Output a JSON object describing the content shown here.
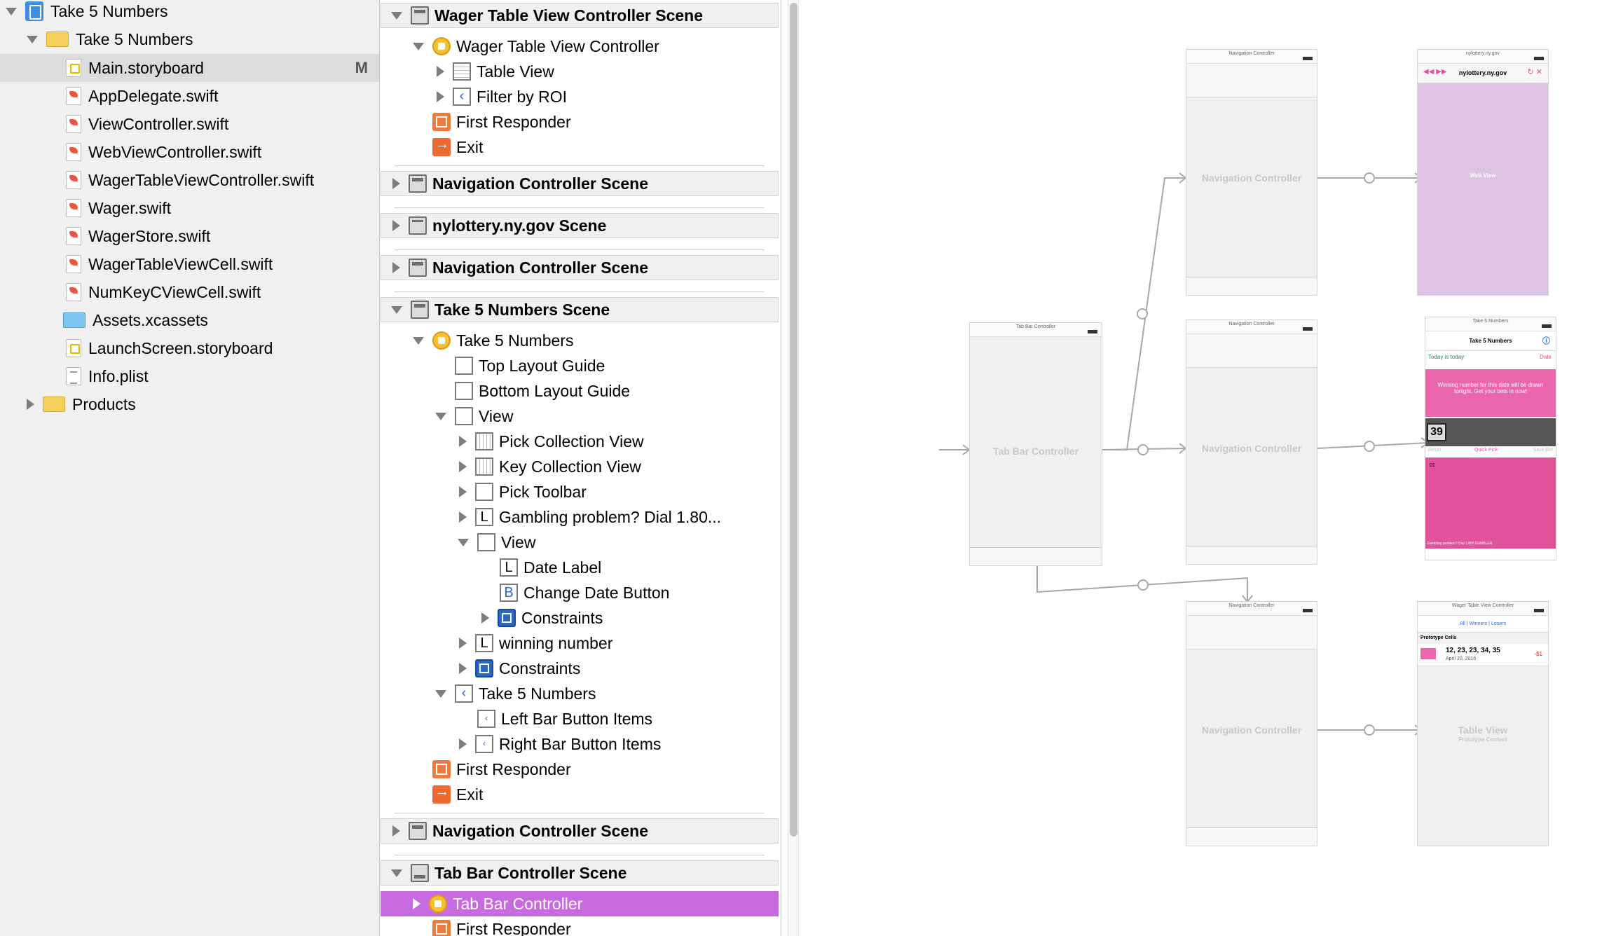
{
  "navigator": {
    "project": "Take 5 Numbers",
    "group": "Take 5 Numbers",
    "files": [
      {
        "name": "Main.storyboard",
        "badge": "M"
      },
      {
        "name": "AppDelegate.swift"
      },
      {
        "name": "ViewController.swift"
      },
      {
        "name": "WebViewController.swift"
      },
      {
        "name": "WagerTableViewController.swift"
      },
      {
        "name": "Wager.swift"
      },
      {
        "name": "WagerStore.swift"
      },
      {
        "name": "WagerTableViewCell.swift"
      },
      {
        "name": "NumKeyCViewCell.swift"
      },
      {
        "name": "Assets.xcassets"
      },
      {
        "name": "LaunchScreen.storyboard"
      },
      {
        "name": "Info.plist"
      }
    ],
    "products": "Products"
  },
  "outline": {
    "wager_scene": "Wager Table View Controller Scene",
    "wager_vc": "Wager Table View Controller",
    "table_view": "Table View",
    "filter_roi": "Filter by ROI",
    "first_responder": "First Responder",
    "exit": "Exit",
    "nav_scene_1": "Navigation Controller Scene",
    "lottery_scene": "nylottery.ny.gov Scene",
    "nav_scene_2": "Navigation Controller Scene",
    "take5_scene": "Take 5 Numbers Scene",
    "take5_vc": "Take 5 Numbers",
    "top_guide": "Top Layout Guide",
    "bottom_guide": "Bottom Layout Guide",
    "view": "View",
    "pick_cv": "Pick Collection View",
    "key_cv": "Key Collection View",
    "pick_toolbar": "Pick Toolbar",
    "gambling": "Gambling problem? Dial 1.80...",
    "inner_view": "View",
    "date_label": "Date Label",
    "change_date": "Change Date Button",
    "constraints_a": "Constraints",
    "winning_number": "winning number",
    "constraints_b": "Constraints",
    "nav_item": "Take 5 Numbers",
    "left_bar": "Left Bar Button Items",
    "right_bar": "Right Bar Button Items",
    "first_responder_2": "First Responder",
    "exit_2": "Exit",
    "nav_scene_3": "Navigation Controller Scene",
    "tab_scene": "Tab Bar Controller Scene",
    "tab_controller": "Tab Bar Controller",
    "first_responder_3": "First Responder"
  },
  "canvas": {
    "tab_bar_controller": "Tab Bar Controller",
    "navigation_controller": "Navigation Controller",
    "web_title": "nylottery.ny.gov",
    "web_view": "Web View",
    "take5_title": "Take 5 Numbers",
    "today_label": "Today is today",
    "date_btn": "Date",
    "winning_text": "Winning number for this date will be drawn tonight. Get your bets in now!",
    "pick_value": "39",
    "toolbar_reset": "Reset",
    "toolbar_quick": "Quick Pick",
    "toolbar_save": "Save Bet",
    "key_value": "01",
    "gambling_footer": "Gambling problem? Dial 1.800.GAMBLER",
    "wager_title": "Wager Table View Controller",
    "seg_all": "All",
    "seg_winners": "Winners",
    "seg_losers": "Losers",
    "prototype": "Prototype Cells",
    "cell_numbers": "12, 23, 23, 34, 35",
    "cell_date": "April 20, 2016",
    "cell_amount": "-$1",
    "table_view": "Table View",
    "proto_content": "Prototype Content"
  },
  "colors": {
    "selection": "#c86be0",
    "pink": "#e0529a",
    "light_pink": "#ea66ad",
    "lavender": "#ddc4e2"
  }
}
